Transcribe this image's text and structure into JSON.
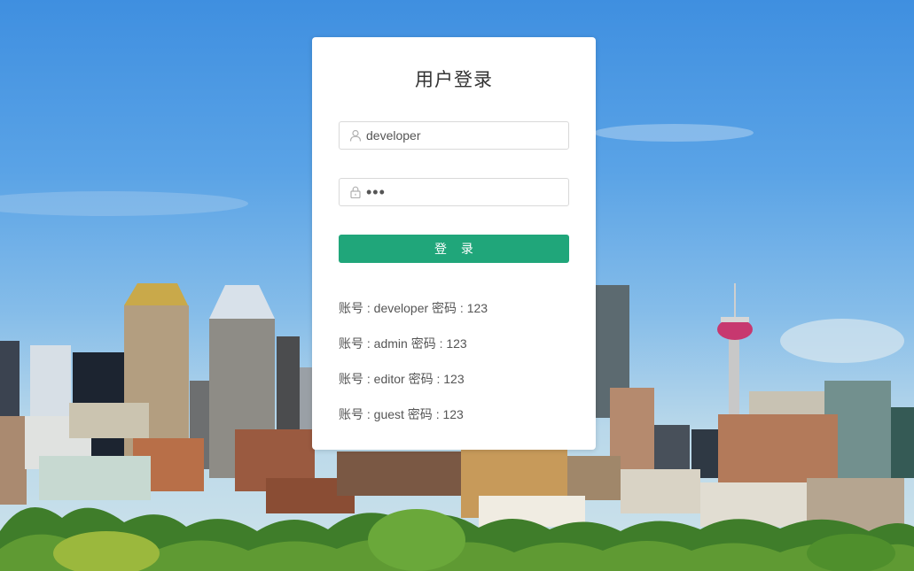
{
  "login": {
    "title": "用户登录",
    "username_value": "developer",
    "password_value": "•••",
    "button_label": "登 录"
  },
  "accounts": [
    "账号 : developer 密码 : 123",
    "账号 : admin 密码 : 123",
    "账号 : editor 密码 : 123",
    "账号 : guest 密码 : 123"
  ],
  "icons": {
    "username": "user-icon",
    "password": "lock-icon"
  },
  "colors": {
    "primary_button": "#20a67a",
    "card_background": "#ffffff",
    "sky": "#4a97e2"
  }
}
